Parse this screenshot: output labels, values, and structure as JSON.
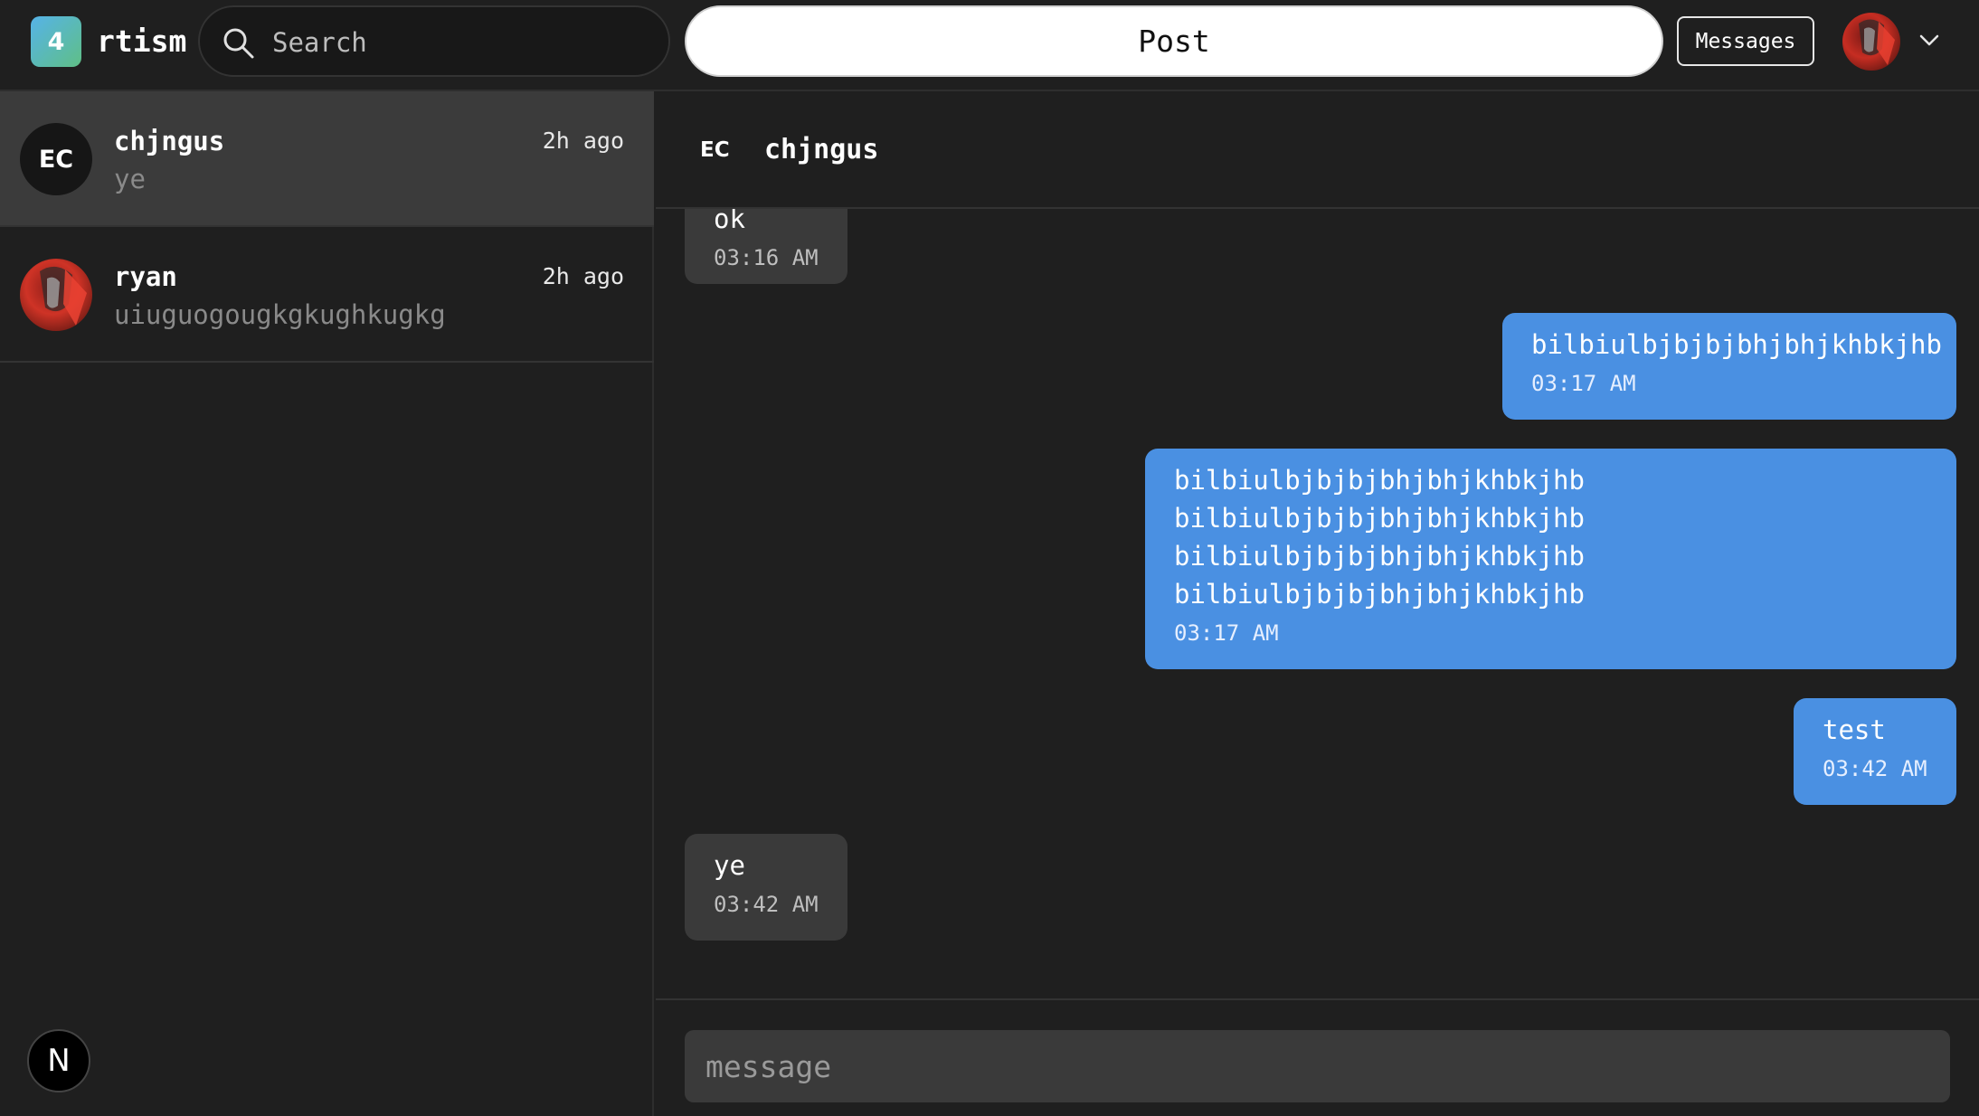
{
  "header": {
    "logo_text": "4",
    "brand": "rtism",
    "search_placeholder": "Search",
    "post_label": "Post",
    "messages_label": "Messages"
  },
  "conversations": [
    {
      "initials": "EC",
      "name": "chjngus",
      "time": "2h ago",
      "preview": "ye",
      "active": true
    },
    {
      "initials": "",
      "name": "ryan",
      "time": "2h ago",
      "preview": "uiuguogougkgkughkugkg",
      "active": false
    }
  ],
  "chat": {
    "initials": "EC",
    "name": "chjngus",
    "messages": [
      {
        "direction": "in",
        "text": "ok",
        "time": "03:16 AM"
      },
      {
        "direction": "out",
        "text": "bilbiulbjbjbjbhjbhjkhbkjhb",
        "time": "03:17 AM"
      },
      {
        "direction": "out",
        "text": "bilbiulbjbjbjbhjbhjkhbkjhb\nbilbiulbjbjbjbhjbhjkhbkjhb\nbilbiulbjbjbjbhjbhjkhbkjhb\nbilbiulbjbjbjbhjbhjkhbkjhb",
        "time": "03:17 AM"
      },
      {
        "direction": "out",
        "text": "test",
        "time": "03:42 AM"
      },
      {
        "direction": "in",
        "text": "ye",
        "time": "03:42 AM"
      }
    ],
    "composer_placeholder": "message"
  },
  "badge": {
    "label": "N"
  },
  "colors": {
    "background": "#1f1f1f",
    "outgoing_bubble": "#4a90e2",
    "incoming_bubble": "#3a3a3a",
    "active_conversation": "#3b3b3b"
  }
}
